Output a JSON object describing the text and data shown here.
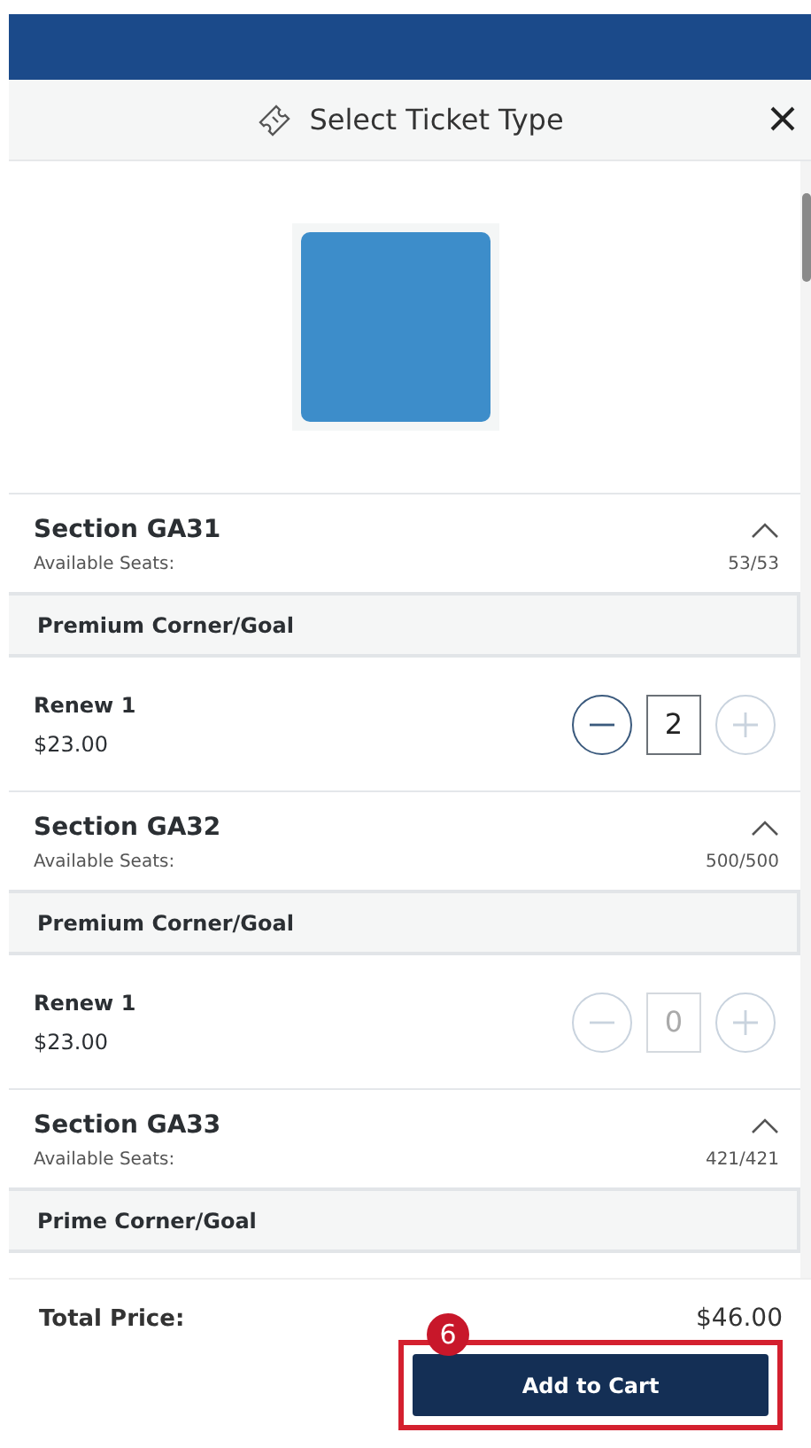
{
  "dialog": {
    "title": "Select Ticket Type"
  },
  "sections": [
    {
      "title": "Section GA31",
      "seats_label": "Available Seats:",
      "seats": "53/53",
      "expanded": true,
      "category": "Premium Corner/Goal",
      "tickets": [
        {
          "name": "Renew 1",
          "price": "$23.00",
          "quantity": "2",
          "minus_enabled": true,
          "plus_enabled": false,
          "quantity_active": true
        }
      ]
    },
    {
      "title": "Section GA32",
      "seats_label": "Available Seats:",
      "seats": "500/500",
      "expanded": true,
      "category": "Premium Corner/Goal",
      "tickets": [
        {
          "name": "Renew 1",
          "price": "$23.00",
          "quantity": "0",
          "minus_enabled": false,
          "plus_enabled": false,
          "quantity_active": false
        }
      ]
    },
    {
      "title": "Section GA33",
      "seats_label": "Available Seats:",
      "seats": "421/421",
      "expanded": true,
      "category": "Prime Corner/Goal"
    }
  ],
  "footer": {
    "total_label": "Total Price:",
    "total": "$46.00",
    "button": "Add to Cart"
  },
  "callout": {
    "number": "6"
  }
}
